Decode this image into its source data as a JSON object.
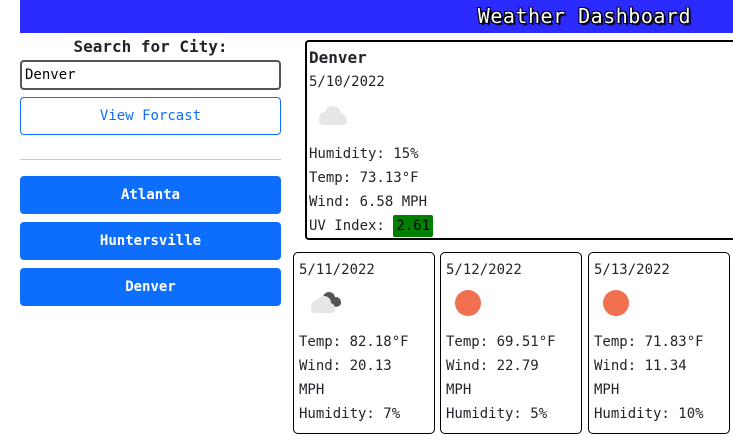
{
  "header": {
    "title": "Weather Dashboard"
  },
  "sidebar": {
    "search_label": "Search for City:",
    "search_value": "Denver",
    "view_button": "View Forcast",
    "history": [
      {
        "label": "Atlanta"
      },
      {
        "label": "Huntersville"
      },
      {
        "label": "Denver"
      }
    ]
  },
  "current": {
    "city": "Denver",
    "date": "5/10/2022",
    "icon": "cloud-icon",
    "humidity": "Humidity: 15%",
    "temp": "Temp: 73.13°F",
    "wind": "Wind: 6.58 MPH",
    "uv_label": "UV Index: ",
    "uv_value": "2.61",
    "uv_color": "#008000"
  },
  "forecast": [
    {
      "date": "5/11/2022",
      "icon": "broken-clouds-icon",
      "temp": "Temp: 82.18°F",
      "wind_line1": "Wind: 20.13",
      "wind_line2": "MPH",
      "humidity": "Humidity: 7%"
    },
    {
      "date": "5/12/2022",
      "icon": "sun-icon",
      "temp": "Temp: 69.51°F",
      "wind_line1": "Wind: 22.79",
      "wind_line2": "MPH",
      "humidity": "Humidity: 5%"
    },
    {
      "date": "5/13/2022",
      "icon": "sun-icon",
      "temp": "Temp: 71.83°F",
      "wind_line1": "Wind: 11.34",
      "wind_line2": "MPH",
      "humidity": "Humidity: 10%"
    }
  ],
  "colors": {
    "header_bg": "#2b2bff",
    "primary": "#0d6efd",
    "sun": "#f07050"
  }
}
